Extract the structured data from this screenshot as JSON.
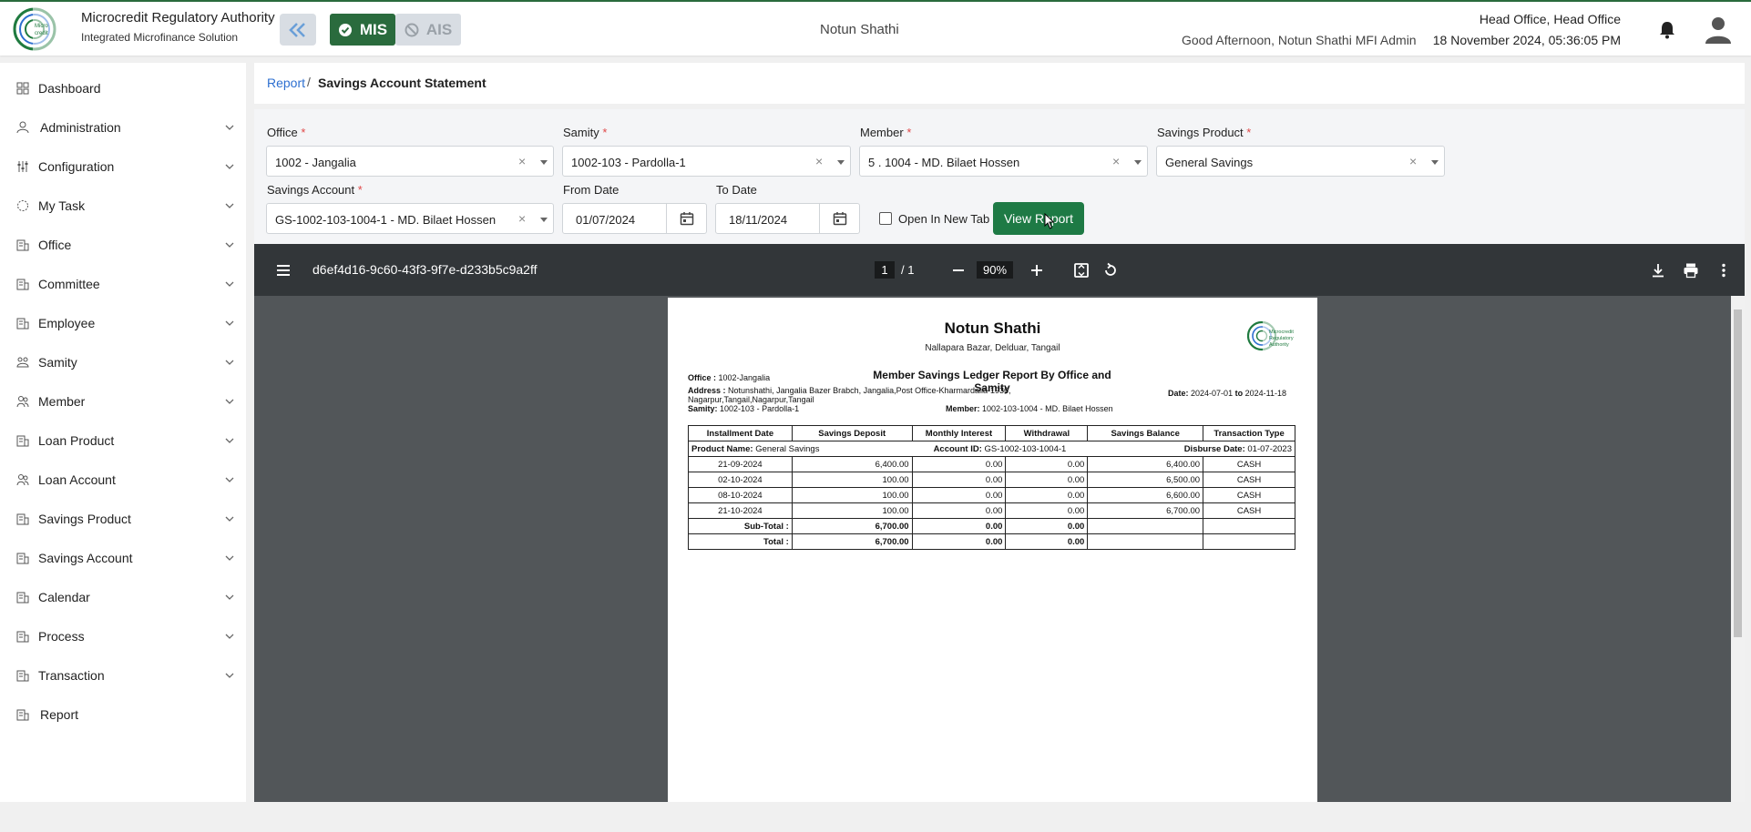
{
  "header": {
    "brand_title": "Microcredit Regulatory Authority",
    "brand_subtitle": "Integrated Microfinance Solution",
    "logo_text": "Microcredit Regulatory Authority",
    "mis_label": "MIS",
    "ais_label": "AIS",
    "organization": "Notun Shathi",
    "office": "Head Office, Head Office",
    "greeting": "Good Afternoon, Notun Shathi MFI Admin",
    "datetime": "18 November 2024, 05:36:05 PM"
  },
  "sidebar": {
    "items": [
      {
        "label": "Dashboard",
        "icon": "dashboard-icon",
        "has_children": false
      },
      {
        "label": "Administration",
        "icon": "administration-icon",
        "has_children": true
      },
      {
        "label": "Configuration",
        "icon": "configuration-icon",
        "has_children": true
      },
      {
        "label": "My Task",
        "icon": "task-icon",
        "has_children": true
      },
      {
        "label": "Office",
        "icon": "office-icon",
        "has_children": true
      },
      {
        "label": "Committee",
        "icon": "committee-icon",
        "has_children": true
      },
      {
        "label": "Employee",
        "icon": "employee-icon",
        "has_children": true
      },
      {
        "label": "Samity",
        "icon": "samity-icon",
        "has_children": true
      },
      {
        "label": "Member",
        "icon": "member-icon",
        "has_children": true
      },
      {
        "label": "Loan Product",
        "icon": "loan-product-icon",
        "has_children": true
      },
      {
        "label": "Loan Account",
        "icon": "loan-account-icon",
        "has_children": true
      },
      {
        "label": "Savings Product",
        "icon": "savings-product-icon",
        "has_children": true
      },
      {
        "label": "Savings Account",
        "icon": "savings-account-icon",
        "has_children": true
      },
      {
        "label": "Calendar",
        "icon": "calendar-icon",
        "has_children": true
      },
      {
        "label": "Process",
        "icon": "process-icon",
        "has_children": true
      },
      {
        "label": "Transaction",
        "icon": "transaction-icon",
        "has_children": true
      },
      {
        "label": "Report",
        "icon": "report-icon",
        "has_children": false
      }
    ]
  },
  "breadcrumb": {
    "parent": "Report",
    "separator": "/",
    "current": "Savings Account Statement"
  },
  "filters": {
    "office": {
      "label": "Office",
      "required": "*",
      "value": "1002 - Jangalia"
    },
    "samity": {
      "label": "Samity",
      "required": "*",
      "value": "1002-103 - Pardolla-1"
    },
    "member": {
      "label": "Member",
      "required": "*",
      "value": "5 . 1004 - MD. Bilaet Hossen"
    },
    "savings_product": {
      "label": "Savings Product",
      "required": "*",
      "value": "General Savings"
    },
    "savings_account": {
      "label": "Savings Account",
      "required": "*",
      "value": "GS-1002-103-1004-1 - MD. Bilaet Hossen"
    },
    "from_date": {
      "label": "From Date",
      "value": "01/07/2024"
    },
    "to_date": {
      "label": "To Date",
      "value": "18/11/2024"
    },
    "open_new_tab": {
      "label": "Open In New Tab",
      "checked": false
    },
    "view_button": "View Report",
    "clear_symbol": "×"
  },
  "pdf_viewer": {
    "file_name": "d6ef4d16-9c60-43f3-9f7e-d233b5c9a2ff",
    "current_page": "1",
    "total_pages": "/   1",
    "zoom": "90%"
  },
  "report": {
    "org_name": "Notun Shathi",
    "org_address": "Nallapara Bazar, Delduar, Tangail",
    "title": "Member Savings Ledger Report By Office and Samity",
    "office_label": "Office :",
    "office_value": "1002-Jangalia",
    "address_label": "Address :",
    "address_value_1": "Notunshathi, Jangalia Bazer Brabch, Jangalia,Post Office-Kharmardalia-1936,",
    "address_value_2": "Nagarpur,Tangail,Nagarpur,Tangail",
    "samity_label": "Samity:",
    "samity_value": "1002-103 - Pardolla-1",
    "date_label": "Date:",
    "date_from": "2024-07-01",
    "date_to_word": "to",
    "date_to": "2024-11-18",
    "member_label": "Member:",
    "member_value": "1002-103-1004 - MD. Bilaet Hossen",
    "columns": [
      "Installment Date",
      "Savings Deposit",
      "Monthly Interest",
      "Withdrawal",
      "Savings Balance",
      "Transaction Type"
    ],
    "product_label": "Product Name:",
    "product_value": "General Savings",
    "account_label": "Account ID:",
    "account_value": "GS-1002-103-1004-1",
    "disburse_label": "Disburse Date:",
    "disburse_value": "01-07-2023",
    "rows": [
      [
        "21-09-2024",
        "6,400.00",
        "0.00",
        "0.00",
        "6,400.00",
        "CASH"
      ],
      [
        "02-10-2024",
        "100.00",
        "0.00",
        "0.00",
        "6,500.00",
        "CASH"
      ],
      [
        "08-10-2024",
        "100.00",
        "0.00",
        "0.00",
        "6,600.00",
        "CASH"
      ],
      [
        "21-10-2024",
        "100.00",
        "0.00",
        "0.00",
        "6,700.00",
        "CASH"
      ]
    ],
    "subtotal": [
      "Sub-Total :",
      "6,700.00",
      "0.00",
      "0.00"
    ],
    "total": [
      "Total :",
      "6,700.00",
      "0.00",
      "0.00"
    ],
    "logo_text": "Microcredit Regulatory Authority"
  },
  "colors": {
    "brand_green": "#2a6b3d",
    "button_green": "#1e7a45",
    "link_blue": "#2d6fd0",
    "pdf_toolbar": "#323639",
    "pdf_background": "#525659"
  }
}
